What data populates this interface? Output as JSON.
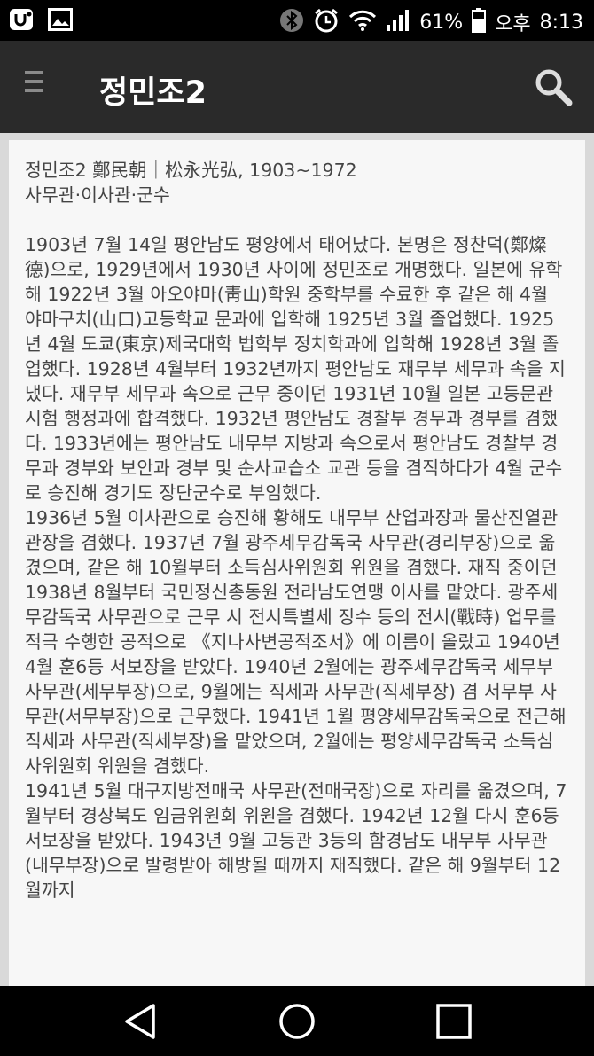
{
  "status_bar": {
    "battery_percent": "61%",
    "ampm": "오후",
    "time": "8:13",
    "icons": [
      "app-notification-icon",
      "image-notification-icon",
      "bluetooth-icon",
      "alarm-icon",
      "wifi-icon",
      "signal-icon",
      "battery-icon"
    ]
  },
  "app_bar": {
    "title": "정민조2",
    "menu_icon": "menu-icon",
    "search_icon": "search-icon"
  },
  "article": {
    "heading": "정민조2 鄭民朝｜松永光弘, 1903~1972",
    "subheading": "사무관·이사관·군수",
    "paragraphs": [
      "1903년 7월 14일 평안남도 평양에서 태어났다. 본명은 정찬덕(鄭燦德)으로, 1929년에서 1930년 사이에 정민조로 개명했다. 일본에 유학해 1922년 3월 아오야마(靑山)학원 중학부를 수료한 후 같은 해 4월 야마구치(山口)고등학교 문과에 입학해 1925년 3월 졸업했다. 1925년 4월 도쿄(東京)제국대학 법학부 정치학과에 입학해 1928년 3월 졸업했다. 1928년 4월부터 1932년까지 평안남도 재무부 세무과 속을 지냈다. 재무부 세무과 속으로 근무 중이던 1931년 10월 일본 고등문관시험 행정과에 합격했다. 1932년 평안남도 경찰부 경무과 경부를 겸했다. 1933년에는 평안남도 내무부 지방과 속으로서 평안남도 경찰부 경무과 경부와 보안과 경부 및 순사교습소 교관 등을 겸직하다가 4월 군수로 승진해 경기도 장단군수로 부임했다.",
      "1936년 5월 이사관으로 승진해 황해도 내무부 산업과장과 물산진열관 관장을 겸했다. 1937년 7월 광주세무감독국 사무관(경리부장)으로 옮겼으며, 같은 해 10월부터 소득심사위원회 위원을 겸했다. 재직 중이던 1938년 8월부터 국민정신총동원 전라남도연맹 이사를 맡았다. 광주세무감독국 사무관으로 근무 시 전시특별세 징수 등의 전시(戰時) 업무를 적극 수행한 공적으로 《지나사변공적조서》에 이름이 올랐고 1940년 4월 훈6등 서보장을 받았다. 1940년 2월에는 광주세무감독국 세무부 사무관(세무부장)으로, 9월에는 직세과 사무관(직세부장) 겸 서무부 사무관(서무부장)으로 근무했다. 1941년 1월 평양세무감독국으로 전근해 직세과 사무관(직세부장)을 맡았으며, 2월에는 평양세무감독국 소득심사위원회 위원을 겸했다.",
      "1941년 5월 대구지방전매국 사무관(전매국장)으로 자리를 옮겼으며, 7월부터 경상북도 임금위원회 위원을 겸했다. 1942년 12월 다시 훈6등 서보장을 받았다. 1943년 9월 고등관 3등의 함경남도 내무부 사무관(내무부장)으로 발령받아 해방될 때까지 재직했다. 같은 해 9월부터 12월까지"
    ]
  },
  "nav_bar": {
    "icons": [
      "back-icon",
      "home-icon",
      "recents-icon"
    ]
  }
}
